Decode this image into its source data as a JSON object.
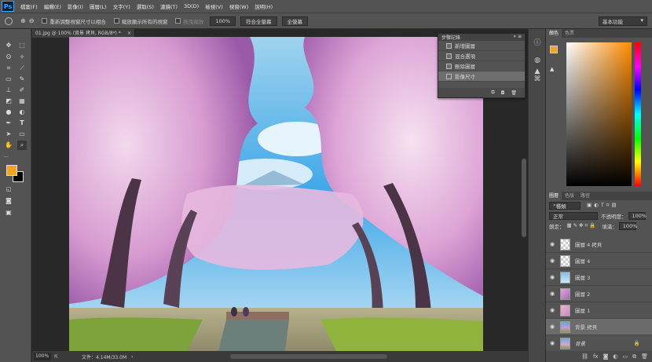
{
  "app": {
    "logo": "Ps"
  },
  "menubar": {
    "items": [
      "檔案(F)",
      "編輯(E)",
      "影像(I)",
      "圖層(L)",
      "文字(Y)",
      "選取(S)",
      "濾鏡(T)",
      "3D(D)",
      "檢視(V)",
      "視窗(W)",
      "說明(H)"
    ]
  },
  "options": {
    "tool_icon": "zoom-icon",
    "resize_windows": "重新調整視窗尺寸以相合",
    "zoom_all_windows": "縮放顯示所有的視窗",
    "scrubby_zoom": "拖曳縮放",
    "zoom_value": "100%",
    "fit_screen": "符合全螢幕",
    "fill_screen": "全螢幕",
    "workspace": "基本功能"
  },
  "document": {
    "tab_title": "01.jpg @ 100% (背景 拷貝, RGB/8*) *",
    "zoom": "100%",
    "doc_size": "文件：4.14M/33.0M"
  },
  "history": {
    "title": "步驟記錄",
    "items": [
      "新增圖層",
      "混合選項",
      "刪除圖層",
      "影像尺寸"
    ]
  },
  "color_panel": {
    "tabs": [
      "顏色",
      "色票"
    ],
    "fg_color": "#f7a41d"
  },
  "layers_panel": {
    "tabs": [
      "圖層",
      "色版",
      "路徑"
    ],
    "filter_kind": "種類",
    "blend_mode": "正常",
    "opacity_label": "不透明度：",
    "opacity": "100%",
    "lock_label": "鎖定：",
    "fill_label": "填滿：",
    "fill": "100%",
    "layers": [
      {
        "name": "圖層 4 拷貝"
      },
      {
        "name": "圖層 4"
      },
      {
        "name": "圖層 3"
      },
      {
        "name": "圖層 2"
      },
      {
        "name": "圖層 1"
      },
      {
        "name": "背景 拷貝"
      },
      {
        "name": "背景"
      }
    ]
  },
  "colors": {
    "ui_bg": "#535353",
    "accent_orange": "#f7a41d"
  }
}
